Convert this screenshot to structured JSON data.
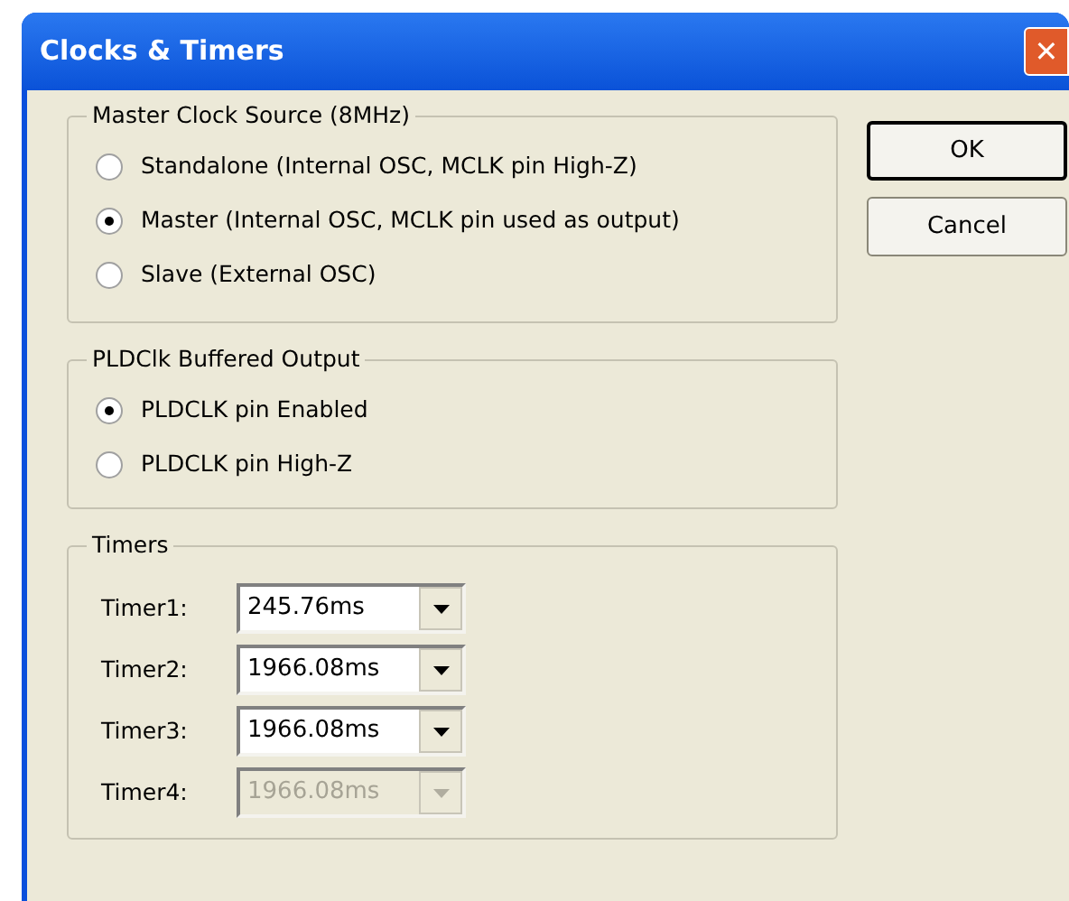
{
  "window": {
    "title": "Clocks & Timers",
    "close": "✕"
  },
  "groups": [
    {
      "title": "Master Clock Source (8MHz)",
      "options": [
        {
          "label": "Standalone (Internal OSC, MCLK pin High-Z)",
          "selected": false
        },
        {
          "label": "Master (Internal OSC, MCLK pin used as output)",
          "selected": true
        },
        {
          "label": "Slave (External OSC)",
          "selected": false
        }
      ]
    },
    {
      "title": "PLDClk Buffered Output",
      "options": [
        {
          "label": "PLDCLK pin Enabled",
          "selected": true
        },
        {
          "label": "PLDCLK pin High-Z",
          "selected": false
        }
      ]
    }
  ],
  "timers": {
    "title": "Timers",
    "items": [
      {
        "label": "Timer1:",
        "value": "245.76ms",
        "disabled": false
      },
      {
        "label": "Timer2:",
        "value": "1966.08ms",
        "disabled": false
      },
      {
        "label": "Timer3:",
        "value": "1966.08ms",
        "disabled": false
      },
      {
        "label": "Timer4:",
        "value": "1966.08ms",
        "disabled": true
      }
    ]
  },
  "buttons": [
    {
      "label": "OK",
      "default": true
    },
    {
      "label": "Cancel",
      "default": false
    }
  ]
}
